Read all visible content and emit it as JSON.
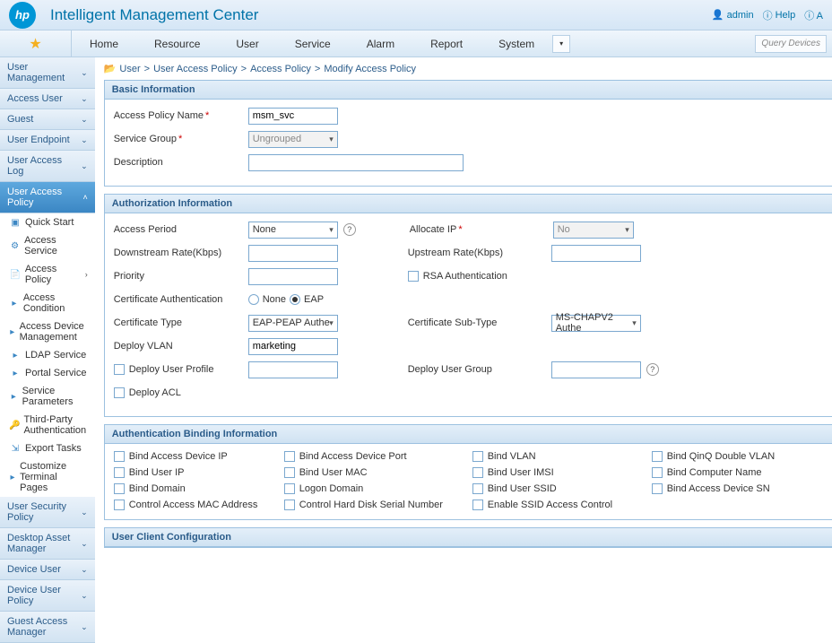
{
  "header": {
    "app_title": "Intelligent Management Center",
    "admin_label": "admin",
    "help_label": "Help",
    "info_label": "A"
  },
  "menu": {
    "items": [
      "Home",
      "Resource",
      "User",
      "Service",
      "Alarm",
      "Report",
      "System"
    ],
    "query_placeholder": "Query Devices"
  },
  "breadcrumb": {
    "parts": [
      "User",
      "User Access Policy",
      "Access Policy",
      "Modify Access Policy"
    ]
  },
  "sidebar": {
    "sections": [
      {
        "label": "User Management"
      },
      {
        "label": "Access User"
      },
      {
        "label": "Guest"
      },
      {
        "label": "User Endpoint"
      },
      {
        "label": "User Access Log"
      },
      {
        "label": "User Access Policy",
        "active": true
      }
    ],
    "sub": [
      {
        "icon": "quick-start-icon",
        "label": "Quick Start"
      },
      {
        "icon": "access-service-icon",
        "label": "Access Service"
      },
      {
        "icon": "access-policy-icon",
        "label": "Access Policy",
        "arrow": true
      },
      {
        "icon": "bullet-icon",
        "label": "Access Condition"
      },
      {
        "icon": "bullet-icon",
        "label": "Access Device Management"
      },
      {
        "icon": "bullet-icon",
        "label": "LDAP Service"
      },
      {
        "icon": "bullet-icon",
        "label": "Portal Service"
      },
      {
        "icon": "bullet-icon",
        "label": "Service Parameters"
      },
      {
        "icon": "third-party-icon",
        "label": "Third-Party Authentication"
      },
      {
        "icon": "export-icon",
        "label": "Export Tasks"
      },
      {
        "icon": "bullet-icon",
        "label": "Customize Terminal Pages"
      }
    ],
    "tail": [
      {
        "label": "User Security Policy"
      },
      {
        "label": "Desktop Asset Manager"
      },
      {
        "label": "Device User"
      },
      {
        "label": "Device User Policy"
      },
      {
        "label": "Guest Access Manager"
      }
    ]
  },
  "panels": {
    "basic": {
      "title": "Basic Information",
      "name_label": "Access Policy Name",
      "name_value": "msm_svc",
      "group_label": "Service Group",
      "group_value": "Ungrouped",
      "desc_label": "Description"
    },
    "auth": {
      "title": "Authorization Information",
      "period_label": "Access Period",
      "period_value": "None",
      "allocate_label": "Allocate IP",
      "allocate_value": "No",
      "down_label": "Downstream Rate(Kbps)",
      "up_label": "Upstream Rate(Kbps)",
      "priority_label": "Priority",
      "rsa_label": "RSA Authentication",
      "certauth_label": "Certificate Authentication",
      "radio_none": "None",
      "radio_eap": "EAP",
      "certtype_label": "Certificate Type",
      "certtype_value": "EAP-PEAP Authe",
      "certsub_label": "Certificate Sub-Type",
      "certsub_value": "MS-CHAPV2 Authe",
      "vlan_label": "Deploy VLAN",
      "vlan_value": "marketing",
      "deploy_profile": "Deploy User Profile",
      "deploy_group_label": "Deploy User Group",
      "deploy_acl": "Deploy ACL"
    },
    "bind": {
      "title": "Authentication Binding Information",
      "items": [
        "Bind Access Device IP",
        "Bind Access Device Port",
        "Bind VLAN",
        "Bind QinQ Double VLAN",
        "Bind User IP",
        "Bind User MAC",
        "Bind User IMSI",
        "Bind Computer Name",
        "Bind Domain",
        "Logon Domain",
        "Bind User SSID",
        "Bind Access Device SN",
        "Control Access MAC Address",
        "Control Hard Disk Serial Number",
        "Enable SSID Access Control",
        ""
      ]
    },
    "client": {
      "title": "User Client Configuration"
    }
  }
}
